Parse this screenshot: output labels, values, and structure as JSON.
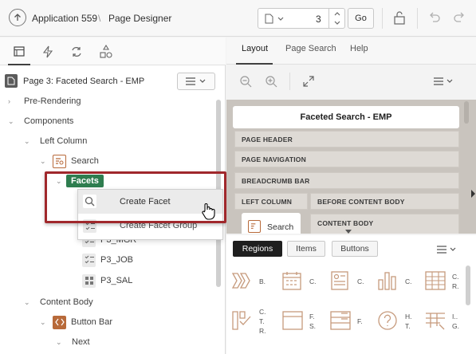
{
  "header": {
    "app_label": "Application 559",
    "separator": "\\",
    "page_designer_label": "Page Designer",
    "page_number": "3",
    "go_label": "Go"
  },
  "left": {
    "page_title": "Page 3: Faceted Search - EMP",
    "tree": {
      "pre_rendering": "Pre-Rendering",
      "components": "Components",
      "left_column": "Left Column",
      "search": "Search",
      "facets": "Facets",
      "p3_mgr": "P3_MGR",
      "p3_job": "P3_JOB",
      "p3_sal": "P3_SAL",
      "content_body": "Content Body",
      "button_bar": "Button Bar",
      "next": "Next"
    },
    "context_menu": {
      "create_facet": "Create Facet",
      "create_facet_group": "Create Facet Group"
    }
  },
  "right": {
    "tabs": [
      "Layout",
      "Page Search",
      "Help"
    ],
    "layout": {
      "page_title": "Faceted Search - EMP",
      "page_header": "PAGE HEADER",
      "page_navigation": "PAGE NAVIGATION",
      "breadcrumb_bar": "BREADCRUMB BAR",
      "left_column": "LEFT COLUMN",
      "before_content_body": "BEFORE CONTENT BODY",
      "content_body": "CONTENT BODY",
      "search_region": "Search"
    },
    "gallery": {
      "tabs": [
        "Regions",
        "Items",
        "Buttons"
      ],
      "items": [
        {
          "icon": "breadcrumb-icon",
          "label": "B."
        },
        {
          "icon": "calendar-icon",
          "label": "C."
        },
        {
          "icon": "cards-icon",
          "label": "C."
        },
        {
          "icon": "chart-icon",
          "label": "C."
        },
        {
          "icon": "classic-report-icon",
          "label": "C.\nR."
        },
        {
          "icon": "column-toggle-icon",
          "label": "C.\nT.\nR."
        },
        {
          "icon": "faceted-search-icon",
          "label": "F.\nS."
        },
        {
          "icon": "form-icon",
          "label": "F."
        },
        {
          "icon": "help-text-icon",
          "label": "H.\nT."
        },
        {
          "icon": "interactive-grid-icon",
          "label": "I..\nG."
        }
      ]
    }
  },
  "colors": {
    "facets_badge": "#2e7d4f",
    "highlight_border": "#a0282c",
    "icon_brown": "#b86a3a"
  }
}
